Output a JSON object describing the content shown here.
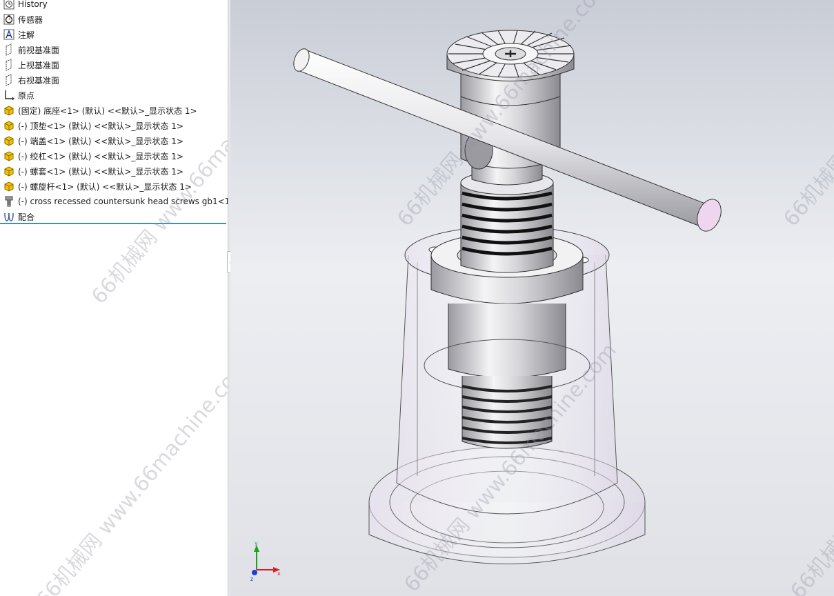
{
  "feature_tree": {
    "items": [
      {
        "label": "History",
        "icon": "history-icon"
      },
      {
        "label": "传感器",
        "icon": "sensor-icon"
      },
      {
        "label": "注解",
        "icon": "annotation-icon"
      },
      {
        "label": "前视基准面",
        "icon": "plane-icon"
      },
      {
        "label": "上视基准面",
        "icon": "plane-icon"
      },
      {
        "label": "右视基准面",
        "icon": "plane-icon"
      },
      {
        "label": "原点",
        "icon": "origin-icon"
      },
      {
        "label": "(固定) 底座<1> (默认) <<默认>_显示状态 1>",
        "icon": "part-icon"
      },
      {
        "label": "(-) 顶垫<1> (默认) <<默认>_显示状态 1>",
        "icon": "part-icon"
      },
      {
        "label": "(-) 端盖<1> (默认) <<默认>_显示状态 1>",
        "icon": "part-icon"
      },
      {
        "label": "(-) 绞杠<1> (默认) <<默认>_显示状态 1>",
        "icon": "part-icon"
      },
      {
        "label": "(-) 螺套<1> (默认) <<默认>_显示状态 1>",
        "icon": "part-icon"
      },
      {
        "label": "(-) 螺旋杆<1> (默认) <<默认>_显示状态 1>",
        "icon": "part-icon"
      },
      {
        "label": "(-) cross recessed countersunk head screws gb1<1:",
        "icon": "screw-icon"
      },
      {
        "label": "配合",
        "icon": "mate-icon"
      }
    ]
  },
  "watermark": "66机械网 www.66machine.com",
  "colors": {
    "selection_line": "#3d8bd4",
    "part_icon": "#e8b400",
    "axis_x": "#d81e1e",
    "axis_y": "#1ea01e",
    "axis_z": "#1e3cd8"
  },
  "triad": {
    "x": "x",
    "y": "y",
    "z": "z"
  }
}
